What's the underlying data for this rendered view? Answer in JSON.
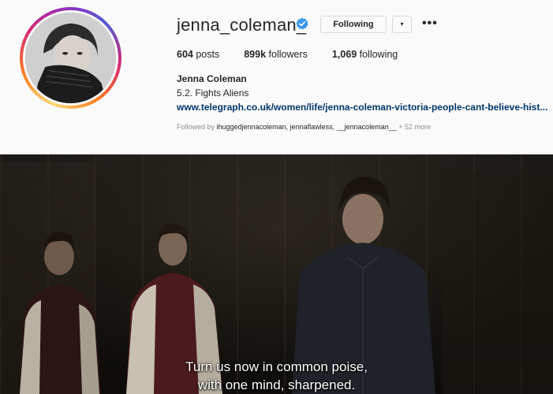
{
  "profile": {
    "username": "jenna_coleman_",
    "verified_icon": "verified-badge-icon",
    "follow_button_label": "Following",
    "dropdown_label": "▾",
    "more_label": "•••",
    "stats": {
      "posts_count": "604",
      "posts_label": "posts",
      "followers_count": "899k",
      "followers_label": "followers",
      "following_count": "1,069",
      "following_label": "following"
    },
    "full_name": "Jenna Coleman",
    "bio": "5.2. Fights Aliens",
    "link": "www.telegraph.co.uk/women/life/jenna-coleman-victoria-people-cant-believe-hist...",
    "followed_by_prefix": "Followed by",
    "followed_by_names": "ihuggedjennacoleman, jennaflawless, __jennacoleman__",
    "followed_by_more": "+ 52 more"
  },
  "video": {
    "subtitle_line1": "Turn us now in common poise,",
    "subtitle_line2": "with one mind, sharpened."
  },
  "colors": {
    "verified": "#3897f0",
    "link": "#00376b",
    "muted": "#8e8e8e"
  }
}
